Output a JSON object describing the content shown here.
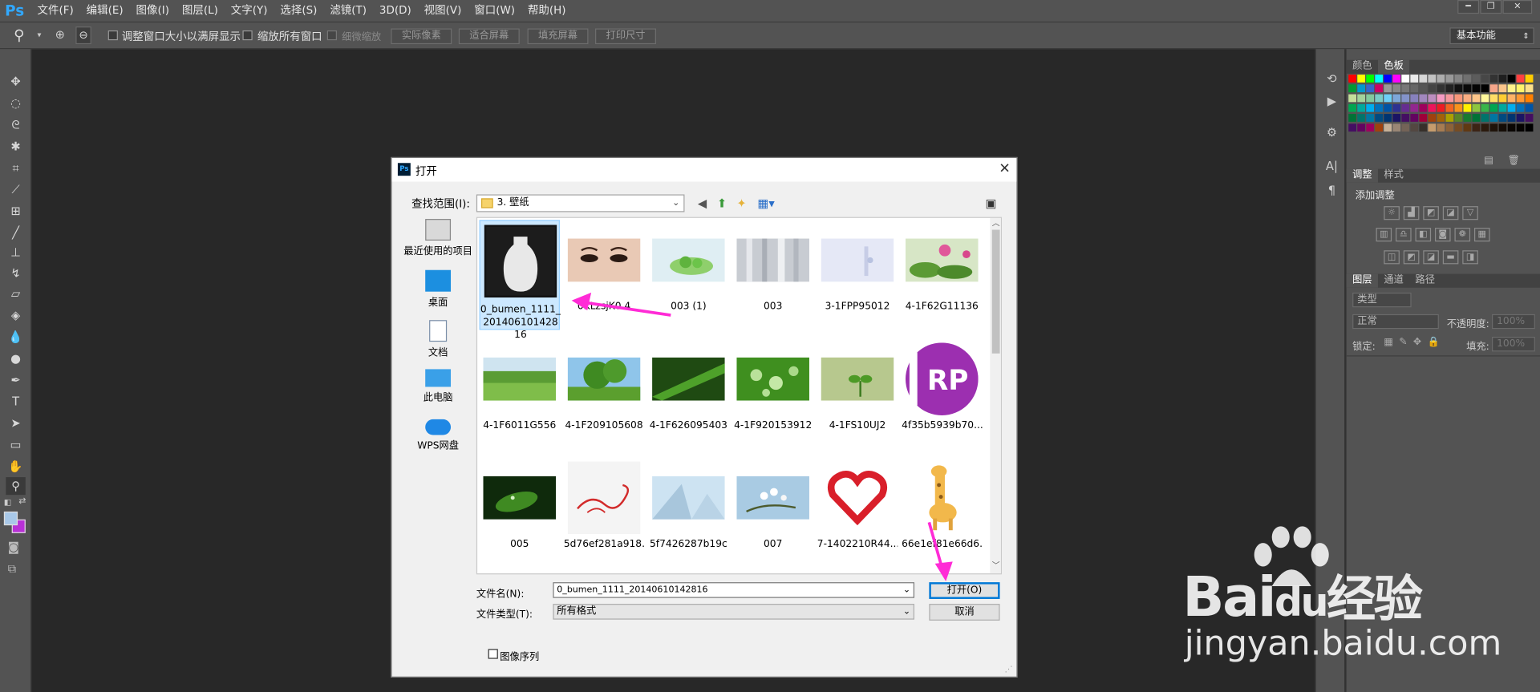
{
  "app": {
    "logo": "Ps"
  },
  "menu": [
    "文件(F)",
    "编辑(E)",
    "图像(I)",
    "图层(L)",
    "文字(Y)",
    "选择(S)",
    "滤镜(T)",
    "3D(D)",
    "视图(V)",
    "窗口(W)",
    "帮助(H)"
  ],
  "options": {
    "resize_label": "调整窗口大小以满屏显示",
    "zoom_all_label": "缩放所有窗口",
    "scrubby_label": "细微缩放",
    "actual_pixels": "实际像素",
    "fit_screen": "适合屏幕",
    "fill_screen": "填充屏幕",
    "print_size": "打印尺寸",
    "workspace": "基本功能"
  },
  "panels": {
    "tabs_color": [
      "颜色",
      "色板"
    ],
    "tabs_adjust": [
      "调整",
      "样式"
    ],
    "add_adjustment": "添加调整",
    "tabs_layers": [
      "图层",
      "通道",
      "路径"
    ],
    "kind": "类型",
    "blend_mode": "正常",
    "opacity_label": "不透明度:",
    "opacity_value": "100%",
    "lock_label": "锁定:",
    "fill_label": "填充:",
    "fill_value": "100%"
  },
  "dialog": {
    "title": "打开",
    "lookin_label": "查找范围(I):",
    "lookin_value": "3. 壁纸",
    "places": [
      "最近使用的项目",
      "桌面",
      "文档",
      "此电脑",
      "WPS网盘"
    ],
    "files": [
      {
        "name": "0_bumen_1111_20140610142816",
        "selected": true,
        "thumb": "vase"
      },
      {
        "name": "0KLzsjK0.4",
        "thumb": "face"
      },
      {
        "name": "003 (1)",
        "thumb": "greenbowl"
      },
      {
        "name": "003",
        "thumb": "curtain"
      },
      {
        "name": "3-1FPP95012",
        "thumb": "pale"
      },
      {
        "name": "4-1F62G11136",
        "thumb": "flower"
      },
      {
        "name": "4-1F6011G556",
        "thumb": "field"
      },
      {
        "name": "4-1F209105608",
        "thumb": "tree"
      },
      {
        "name": "4-1F626095403",
        "thumb": "leaf"
      },
      {
        "name": "4-1F920153912",
        "thumb": "drops"
      },
      {
        "name": "4-1FS10UJ2",
        "thumb": "sprout"
      },
      {
        "name": "4f35b5939b70...",
        "thumb": "rp"
      },
      {
        "name": "005",
        "thumb": "darkleaf"
      },
      {
        "name": "5d76ef281a918...",
        "thumb": "swirl"
      },
      {
        "name": "5f7426287b19c",
        "thumb": "sky"
      },
      {
        "name": "007",
        "thumb": "blossom"
      },
      {
        "name": "7-1402210R44...",
        "thumb": "heart"
      },
      {
        "name": "66e1ef81e66d6...",
        "thumb": "giraffe"
      }
    ],
    "filename_label": "文件名(N):",
    "filename_value": "0_bumen_1111_20140610142816",
    "filetype_label": "文件类型(T):",
    "filetype_value": "所有格式",
    "open_button": "打开(O)",
    "cancel_button": "取消",
    "image_sequence": "图像序列"
  },
  "watermark": {
    "brand": "Bai",
    "brand2": "du",
    "cn": "经验",
    "url": "jingyan.baidu.com"
  }
}
